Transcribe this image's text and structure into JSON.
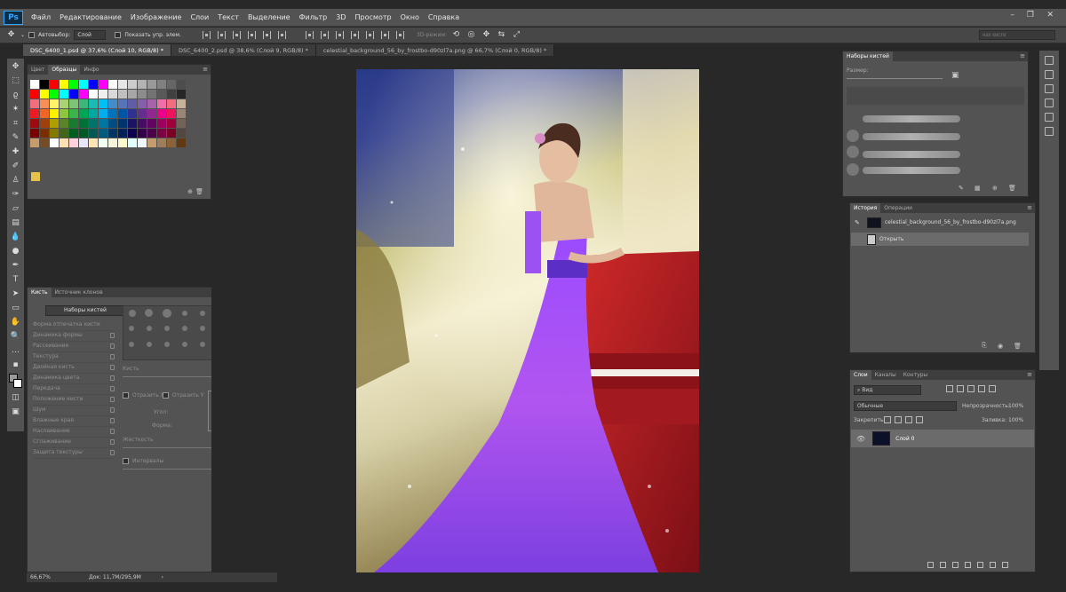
{
  "menubar": {
    "logo": "Ps",
    "items": [
      "Файл",
      "Редактирование",
      "Изображение",
      "Слои",
      "Текст",
      "Выделение",
      "Фильтр",
      "3D",
      "Просмотр",
      "Окно",
      "Справка"
    ]
  },
  "options": {
    "autoselect": "Автовыбор:",
    "autoselect_value": "Слой",
    "show_controls": "Показать упр. элем.",
    "mode3d": "3D-режим:",
    "search_placeholder": "нах кисти"
  },
  "tabs": [
    "DSC_6400_1.psd @ 37,6% (Слой 10, RGB/8) *",
    "DSC_6400_2.psd @ 38,6% (Слой 9, RGB/8) *",
    "celestial_background_56_by_frostbo-d90zl7a.png @ 66,7% (Слой 0, RGB/8) *"
  ],
  "swatches_panel": {
    "tabs": [
      "Цвет",
      "Образцы",
      "Инфо"
    ],
    "colors": [
      [
        "#ffffff",
        "#000000",
        "#ff0000",
        "#ffff00",
        "#00ff00",
        "#00ffff",
        "#0000ff",
        "#ff00ff",
        "#ffffff",
        "#e6e6e6",
        "#cccccc",
        "#b3b3b3",
        "#999999",
        "#808080",
        "#666666",
        "#4d4d4d"
      ],
      [
        "#ff0000",
        "#ffff00",
        "#00ff00",
        "#00ffff",
        "#0000ff",
        "#ff00ff",
        "#fefefe",
        "#f0f0f0",
        "#d9d9d9",
        "#bfbfbf",
        "#a6a6a6",
        "#8c8c8c",
        "#737373",
        "#595959",
        "#404040",
        "#262626"
      ],
      [
        "#f26d7d",
        "#f68e56",
        "#fff467",
        "#acd372",
        "#7cc576",
        "#3bb878",
        "#1abbb4",
        "#00bff3",
        "#438ccb",
        "#5574b9",
        "#605ca8",
        "#855fa8",
        "#a763a9",
        "#ef6ea8",
        "#f16d7e",
        "#c7b299"
      ],
      [
        "#ed1c24",
        "#f26522",
        "#fff200",
        "#8dc63f",
        "#39b54a",
        "#00a651",
        "#00a99d",
        "#00aeef",
        "#0072bc",
        "#0054a6",
        "#2e3192",
        "#662d91",
        "#92278f",
        "#ec008c",
        "#ed145b",
        "#998675"
      ],
      [
        "#9e0b0f",
        "#a0410d",
        "#aba000",
        "#598527",
        "#1a7b30",
        "#007236",
        "#00746b",
        "#0076a3",
        "#004b80",
        "#003471",
        "#1b1464",
        "#440e62",
        "#630460",
        "#9e005d",
        "#9e0039",
        "#736357"
      ],
      [
        "#790000",
        "#7b2e00",
        "#827b00",
        "#406618",
        "#005e20",
        "#005826",
        "#005952",
        "#005b7f",
        "#003663",
        "#002157",
        "#0d004c",
        "#32004b",
        "#4b0049",
        "#7b0046",
        "#7a0026",
        "#534741"
      ],
      [
        "#c69c6d",
        "#754c24",
        "#ffffff",
        "#ffe0b2",
        "#ffd1dc",
        "#e6e6fa",
        "#ffe4b5",
        "#f0fff0",
        "#f5f5dc",
        "#fffacd",
        "#e0ffff",
        "#f0f8ff",
        "#c69c6e",
        "#9e7e5a",
        "#8c6239",
        "#603913"
      ]
    ]
  },
  "brush_panel": {
    "tabs": [
      "Кисть",
      "Источник клонов"
    ],
    "sets_button": "Наборы кистей",
    "options": [
      "Форма отпечатка кисти",
      "Динамика формы",
      "Рассеивание",
      "Текстура",
      "Двойная кисть",
      "Динамика цвета",
      "Передача",
      "Положение кисти",
      "Шум",
      "Влажные края",
      "Наслаивание",
      "Сглаживание",
      "Защита текстуры"
    ],
    "size_label": "Кисть",
    "flip_x": "Отразить X",
    "flip_y": "Отразить Y",
    "angle_label": "Угол:",
    "roundness_label": "Форма:",
    "hardness_label": "Жесткость",
    "spacing_label": "Интервалы"
  },
  "brush_presets": {
    "title": "Наборы кистей",
    "size_label": "Размер:"
  },
  "history": {
    "tabs": [
      "История",
      "Операции"
    ],
    "snapshot": "celestial_background_56_by_frostbo-d90zl7a.png",
    "item": "Открыть"
  },
  "layers": {
    "tabs": [
      "Слои",
      "Каналы",
      "Контуры"
    ],
    "filter": "Вид",
    "blend": "Обычные",
    "opacity_label": "Непрозрачность:",
    "opacity_value": "100%",
    "lock_label": "Закрепить:",
    "fill_label": "Заливка:",
    "fill_value": "100%",
    "layer_name": "Слой 0"
  },
  "status": {
    "zoom": "66,67%",
    "doc": "Док: 11,7M/295,9M"
  }
}
